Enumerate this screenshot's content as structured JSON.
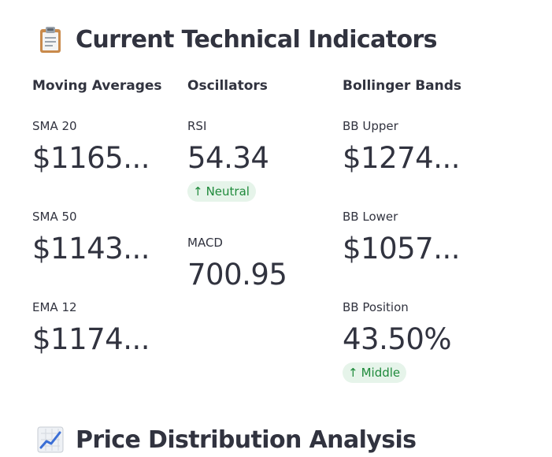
{
  "section_title": "Current Technical Indicators",
  "next_section_title": "Price Distribution Analysis",
  "columns": {
    "moving_averages": {
      "header": "Moving Averages",
      "metrics": [
        {
          "label": "SMA 20",
          "value": "$1165..."
        },
        {
          "label": "SMA 50",
          "value": "$1143..."
        },
        {
          "label": "EMA 12",
          "value": "$1174..."
        }
      ]
    },
    "oscillators": {
      "header": "Oscillators",
      "metrics": [
        {
          "label": "RSI",
          "value": "54.34",
          "delta": "Neutral"
        },
        {
          "label": "MACD",
          "value": "700.95"
        }
      ]
    },
    "bollinger": {
      "header": "Bollinger Bands",
      "metrics": [
        {
          "label": "BB Upper",
          "value": "$1274..."
        },
        {
          "label": "BB Lower",
          "value": "$1057..."
        },
        {
          "label": "BB Position",
          "value": "43.50%",
          "delta": "Middle"
        }
      ]
    }
  },
  "icons": {
    "section_icon": "clipboard-icon",
    "next_section_icon": "chart-increasing-icon",
    "delta_icon": "arrow-up-icon"
  },
  "colors": {
    "text": "#31333f",
    "delta_bg": "#e6f4ea",
    "delta_text": "#1f8a3b"
  }
}
